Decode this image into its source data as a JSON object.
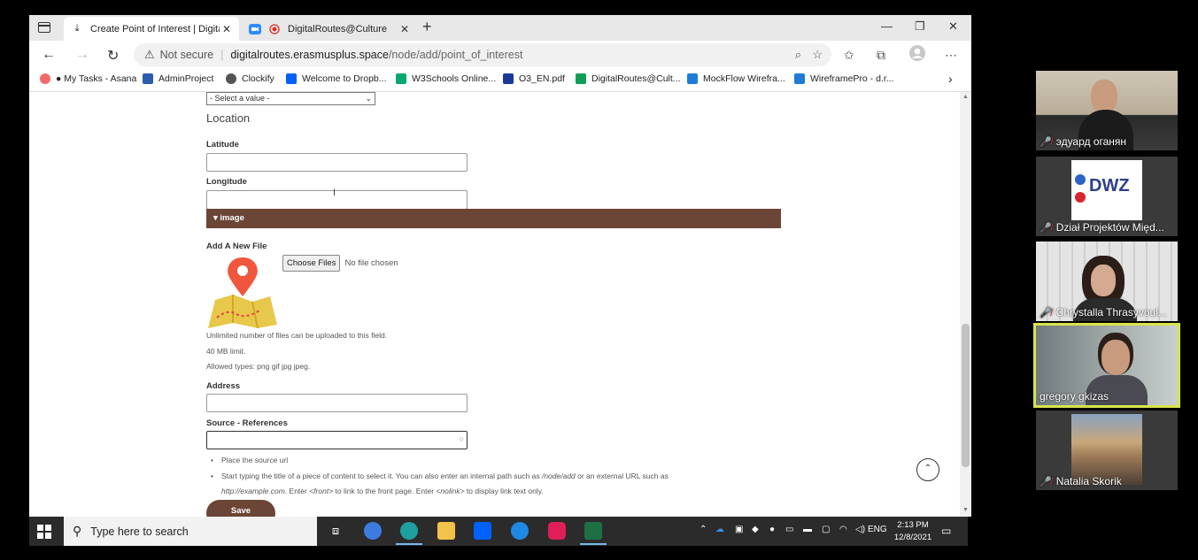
{
  "browser": {
    "tabs": [
      {
        "title": "Create Point of Interest | Digital à",
        "active": true
      },
      {
        "title": "DigitalRoutes@Culture",
        "active": false
      }
    ],
    "address": {
      "security": "Not secure",
      "host": "digitalroutes.erasmusplus.space",
      "path": "/node/add/point_of_interest"
    },
    "bookmarks": [
      {
        "label": "● My Tasks - Asana",
        "color": "#f06a6a"
      },
      {
        "label": "AdminProject",
        "color": "#2a5db0"
      },
      {
        "label": "Clockify",
        "color": "#555555"
      },
      {
        "label": "Welcome to Dropb...",
        "color": "#0061fe"
      },
      {
        "label": "W3Schools Online...",
        "color": "#04aa6d"
      },
      {
        "label": "O3_EN.pdf",
        "color": "#1a3a9a"
      },
      {
        "label": "DigitalRoutes@Cult...",
        "color": "#0f9d58"
      },
      {
        "label": "MockFlow Wirefra...",
        "color": "#1f7bd8"
      },
      {
        "label": "WireframePro - d.r...",
        "color": "#1f7bd8"
      }
    ]
  },
  "form": {
    "select_placeholder": "- Select a value -",
    "location_heading": "Location",
    "latitude_label": "Latitude",
    "longitude_label": "Longitude",
    "image_section": "▾ image",
    "add_file_label": "Add A New File",
    "choose_files": "Choose Files",
    "no_file": "No file chosen",
    "hint_unlimited": "Unlimited number of files can be uploaded to this field.",
    "hint_limit": "40 MB limit.",
    "hint_types": "Allowed types: png gif jpg jpeg.",
    "address_label": "Address",
    "source_label": "Source - References",
    "bullet1": "Place the source url",
    "bullet2_a": "Start typing the title of a piece of content to select it. You can also enter an internal path such as ",
    "bullet2_b": "/node/add",
    "bullet2_c": " or an external URL such as",
    "bullet3_a": "http://example.com",
    "bullet3_b": ". Enter ",
    "bullet3_c": "<front>",
    "bullet3_d": " to link to the front page. Enter ",
    "bullet3_e": "<nolink>",
    "bullet3_f": " to display link text only.",
    "save": "Save",
    "accent_color": "#6b4536"
  },
  "taskbar": {
    "search_placeholder": "Type here to search",
    "language": "ENG",
    "time": "2:13 PM",
    "date": "12/8/2021"
  },
  "participants": [
    {
      "name": "эдуард оганян",
      "muted": true
    },
    {
      "name": "Dział Projektów Międ...",
      "muted": true
    },
    {
      "name": "Chrystalla Thrasyvoul...",
      "muted": true
    },
    {
      "name": "gregory gkizas",
      "muted": false,
      "speaking": true
    },
    {
      "name": "Natalia Skorik",
      "muted": true
    }
  ],
  "dwz_logo": "DWZ"
}
